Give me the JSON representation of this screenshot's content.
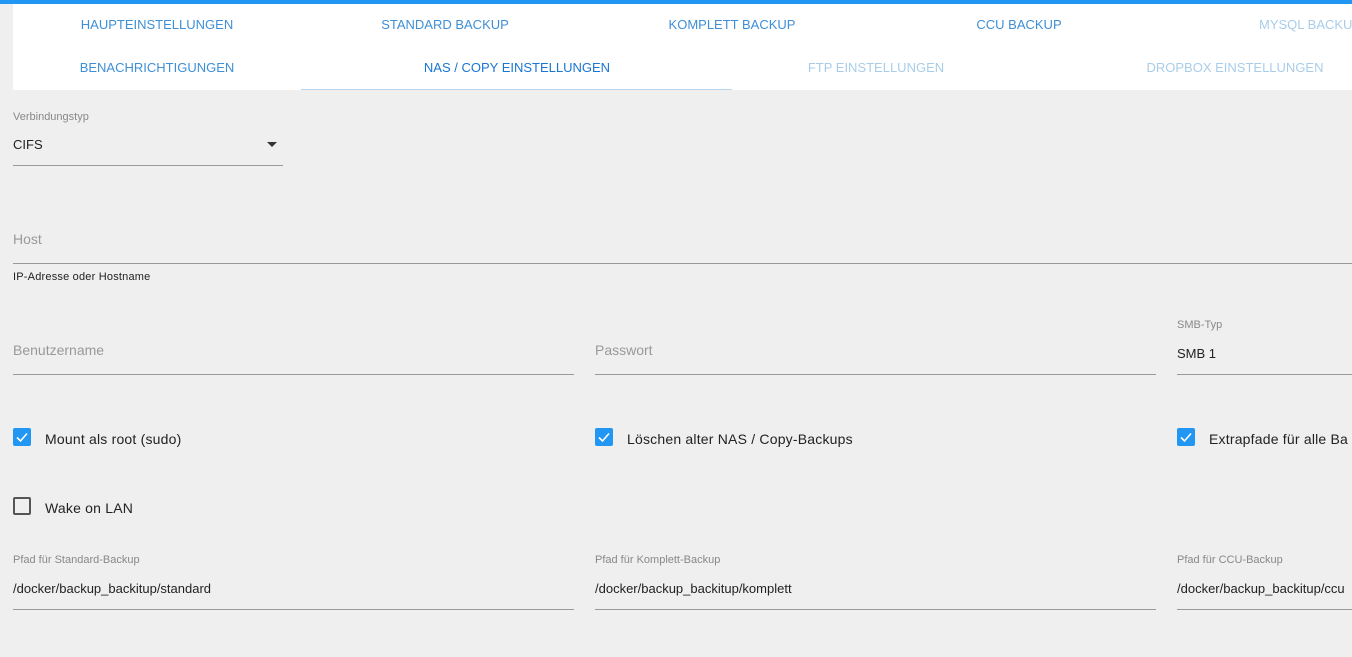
{
  "tabs": {
    "row1": [
      {
        "label": "HAUPTEINSTELLUNGEN"
      },
      {
        "label": "STANDARD BACKUP"
      },
      {
        "label": "KOMPLETT BACKUP"
      },
      {
        "label": "CCU BACKUP"
      },
      {
        "label": "MYSQL BACKUP"
      }
    ],
    "row2": [
      {
        "label": "BENACHRICHTIGUNGEN"
      },
      {
        "label": "NAS / COPY EINSTELLUNGEN"
      },
      {
        "label": "FTP EINSTELLUNGEN"
      },
      {
        "label": "DROPBOX EINSTELLUNGEN"
      }
    ],
    "active": "NAS / COPY EINSTELLUNGEN"
  },
  "form": {
    "connection_type": {
      "label": "Verbindungstyp",
      "value": "CIFS"
    },
    "host": {
      "placeholder": "Host",
      "helper": "IP-Adresse oder Hostname"
    },
    "username": {
      "placeholder": "Benutzername"
    },
    "password": {
      "placeholder": "Passwort"
    },
    "smb_type": {
      "label": "SMB-Typ",
      "value": "SMB 1"
    },
    "checkboxes": [
      {
        "label": "Mount als root (sudo)",
        "checked": true
      },
      {
        "label": "Löschen alter NAS / Copy-Backups",
        "checked": true
      },
      {
        "label": "Extrapfade für alle Ba",
        "checked": true
      },
      {
        "label": "Wake on LAN",
        "checked": false
      }
    ],
    "paths": [
      {
        "label": "Pfad für Standard-Backup",
        "value": "/docker/backup_backitup/standard"
      },
      {
        "label": "Pfad für Komplett-Backup",
        "value": "/docker/backup_backitup/komplett"
      },
      {
        "label": "Pfad für CCU-Backup",
        "value": "/docker/backup_backitup/ccu"
      }
    ]
  },
  "colors": {
    "accent": "#2196f3",
    "tab_text": "#3f8fd6",
    "tab_text_disabled": "#a9cde9",
    "background": "#efefef"
  }
}
